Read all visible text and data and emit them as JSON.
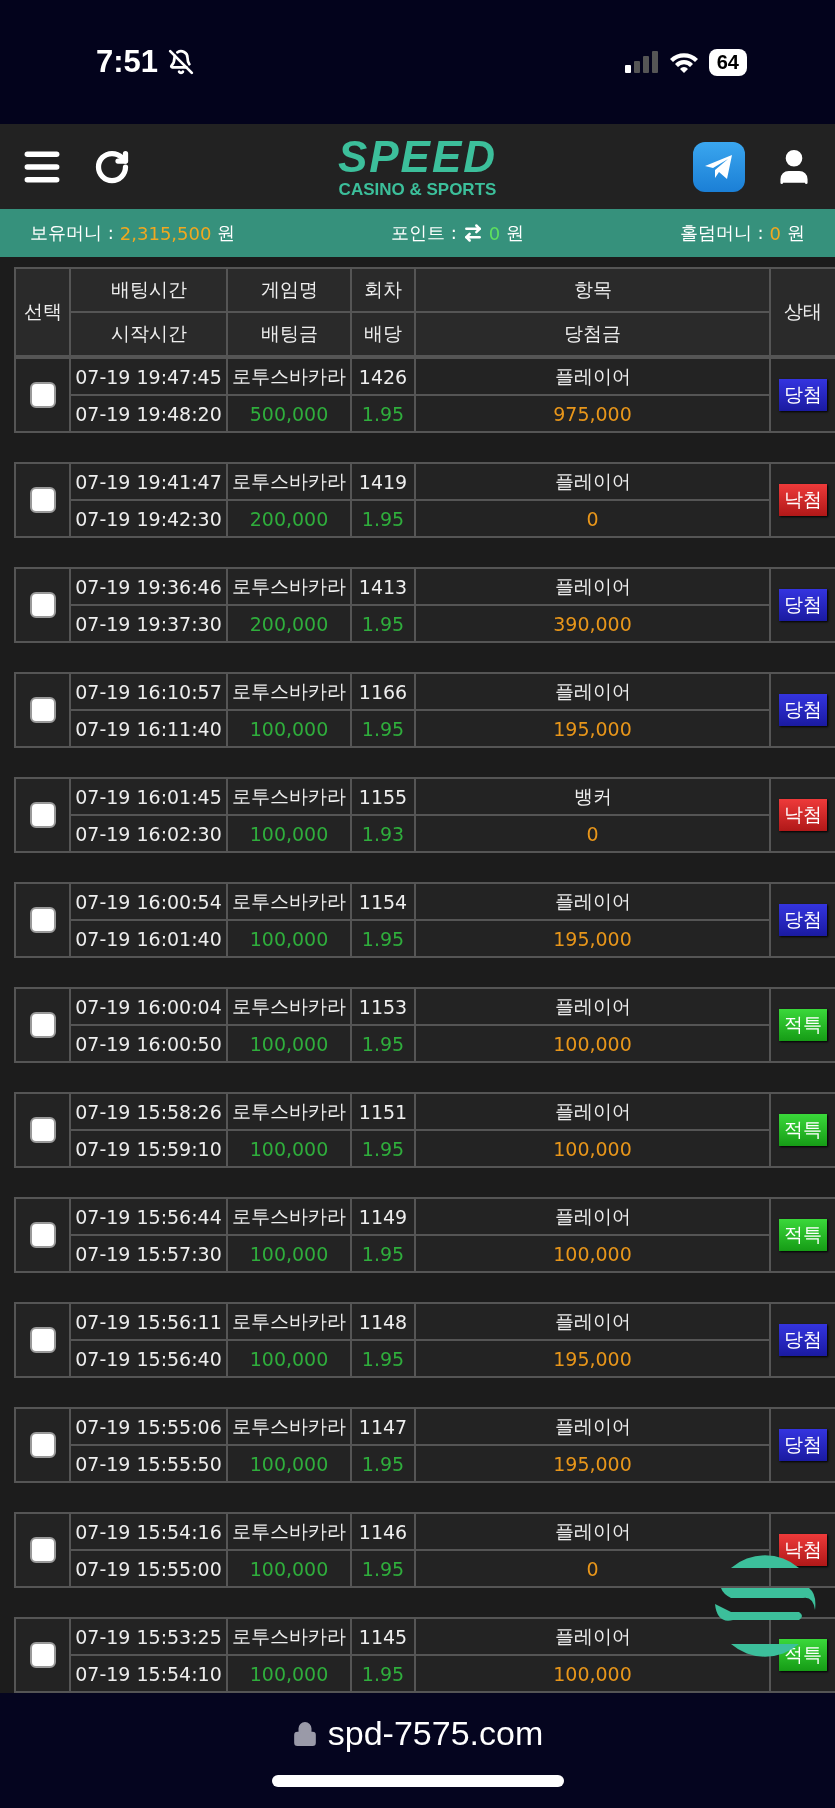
{
  "status_bar": {
    "time": "7:51",
    "battery": "64"
  },
  "header": {
    "logo": "SPEED",
    "logo_sub": "CASINO & SPORTS"
  },
  "balances": [
    {
      "kind": "plain",
      "label": "보유머니 :",
      "value": "2,315,500",
      "unit": "원"
    },
    {
      "kind": "transfer",
      "label": "포인트 :",
      "value": "0",
      "unit": "원"
    },
    {
      "kind": "plain",
      "label": "홀덤머니 :",
      "value": "0",
      "unit": "원"
    }
  ],
  "table": {
    "columns_top": [
      "선택",
      "배팅시간",
      "게임명",
      "회차",
      "항목",
      "상태"
    ],
    "columns_bottom": [
      "시작시간",
      "배팅금",
      "배당",
      "당첨금"
    ],
    "rows": [
      {
        "checked": false,
        "bet_time": "07-19 19:47:45",
        "start_time": "07-19 19:48:20",
        "game": "로투스바카라",
        "round": "1426",
        "amount": "500,000",
        "odds": "1.95",
        "pick": "플레이어",
        "payout": "975,000",
        "status": {
          "label": "당첨",
          "kind": "win"
        }
      },
      {
        "checked": false,
        "bet_time": "07-19 19:41:47",
        "start_time": "07-19 19:42:30",
        "game": "로투스바카라",
        "round": "1419",
        "amount": "200,000",
        "odds": "1.95",
        "pick": "플레이어",
        "payout": "0",
        "status": {
          "label": "낙첨",
          "kind": "lose"
        }
      },
      {
        "checked": false,
        "bet_time": "07-19 19:36:46",
        "start_time": "07-19 19:37:30",
        "game": "로투스바카라",
        "round": "1413",
        "amount": "200,000",
        "odds": "1.95",
        "pick": "플레이어",
        "payout": "390,000",
        "status": {
          "label": "당첨",
          "kind": "win"
        }
      },
      {
        "checked": false,
        "bet_time": "07-19 16:10:57",
        "start_time": "07-19 16:11:40",
        "game": "로투스바카라",
        "round": "1166",
        "amount": "100,000",
        "odds": "1.95",
        "pick": "플레이어",
        "payout": "195,000",
        "status": {
          "label": "당첨",
          "kind": "win"
        }
      },
      {
        "checked": false,
        "bet_time": "07-19 16:01:45",
        "start_time": "07-19 16:02:30",
        "game": "로투스바카라",
        "round": "1155",
        "amount": "100,000",
        "odds": "1.93",
        "pick": "뱅커",
        "payout": "0",
        "status": {
          "label": "낙첨",
          "kind": "lose"
        }
      },
      {
        "checked": false,
        "bet_time": "07-19 16:00:54",
        "start_time": "07-19 16:01:40",
        "game": "로투스바카라",
        "round": "1154",
        "amount": "100,000",
        "odds": "1.95",
        "pick": "플레이어",
        "payout": "195,000",
        "status": {
          "label": "당첨",
          "kind": "win"
        }
      },
      {
        "checked": false,
        "bet_time": "07-19 16:00:04",
        "start_time": "07-19 16:00:50",
        "game": "로투스바카라",
        "round": "1153",
        "amount": "100,000",
        "odds": "1.95",
        "pick": "플레이어",
        "payout": "100,000",
        "status": {
          "label": "적특",
          "kind": "void"
        }
      },
      {
        "checked": false,
        "bet_time": "07-19 15:58:26",
        "start_time": "07-19 15:59:10",
        "game": "로투스바카라",
        "round": "1151",
        "amount": "100,000",
        "odds": "1.95",
        "pick": "플레이어",
        "payout": "100,000",
        "status": {
          "label": "적특",
          "kind": "void"
        }
      },
      {
        "checked": false,
        "bet_time": "07-19 15:56:44",
        "start_time": "07-19 15:57:30",
        "game": "로투스바카라",
        "round": "1149",
        "amount": "100,000",
        "odds": "1.95",
        "pick": "플레이어",
        "payout": "100,000",
        "status": {
          "label": "적특",
          "kind": "void"
        }
      },
      {
        "checked": false,
        "bet_time": "07-19 15:56:11",
        "start_time": "07-19 15:56:40",
        "game": "로투스바카라",
        "round": "1148",
        "amount": "100,000",
        "odds": "1.95",
        "pick": "플레이어",
        "payout": "195,000",
        "status": {
          "label": "당첨",
          "kind": "win"
        }
      },
      {
        "checked": false,
        "bet_time": "07-19 15:55:06",
        "start_time": "07-19 15:55:50",
        "game": "로투스바카라",
        "round": "1147",
        "amount": "100,000",
        "odds": "1.95",
        "pick": "플레이어",
        "payout": "195,000",
        "status": {
          "label": "당첨",
          "kind": "win"
        }
      },
      {
        "checked": false,
        "bet_time": "07-19 15:54:16",
        "start_time": "07-19 15:55:00",
        "game": "로투스바카라",
        "round": "1146",
        "amount": "100,000",
        "odds": "1.95",
        "pick": "플레이어",
        "payout": "0",
        "status": {
          "label": "낙첨",
          "kind": "lose"
        }
      },
      {
        "checked": false,
        "bet_time": "07-19 15:53:25",
        "start_time": "07-19 15:54:10",
        "game": "로투스바카라",
        "round": "1145",
        "amount": "100,000",
        "odds": "1.95",
        "pick": "플레이어",
        "payout": "100,000",
        "status": {
          "label": "적특",
          "kind": "void"
        }
      }
    ]
  },
  "address_bar": {
    "url": "spd-7575.com"
  }
}
